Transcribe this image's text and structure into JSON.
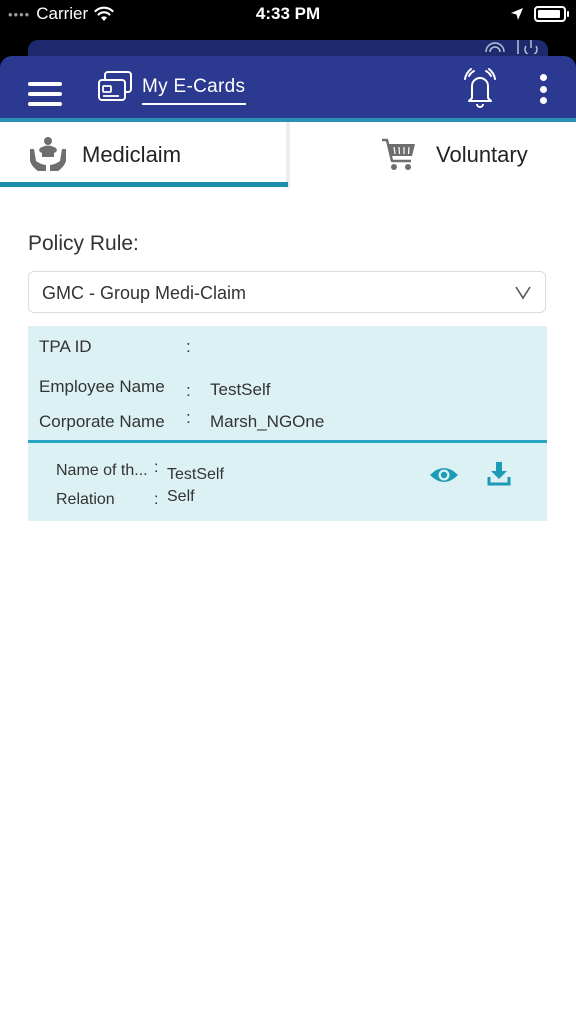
{
  "status_bar": {
    "carrier": "Carrier",
    "time": "4:33 PM"
  },
  "header": {
    "title": "My E-Cards",
    "icons": {
      "menu": "hamburger-icon",
      "card": "ecard-icon",
      "bell": "bell-icon",
      "more": "kebab-icon"
    }
  },
  "tabs": [
    {
      "label": "Mediclaim",
      "icon": "family-care-icon",
      "active": true
    },
    {
      "label": "Voluntary",
      "icon": "cart-icon",
      "active": false
    }
  ],
  "policy": {
    "label": "Policy Rule:",
    "selected": "GMC - Group Medi-Claim"
  },
  "info": {
    "tpa_label": "TPA ID",
    "tpa_value": "",
    "employee_label": "Employee Name",
    "employee_value": "TestSelf",
    "corporate_label": "Corporate Name",
    "corporate_value": "Marsh_NGOne",
    "separator": ":"
  },
  "member": {
    "name_label": "Name of th...",
    "name_value": "TestSelf",
    "relation_label": "Relation",
    "relation_value": "Self",
    "separator": ":"
  },
  "colors": {
    "header": "#2b3990",
    "accent": "#1b8fa9",
    "card_bg": "#dcf1f3",
    "icon_teal": "#1b9bb5"
  }
}
